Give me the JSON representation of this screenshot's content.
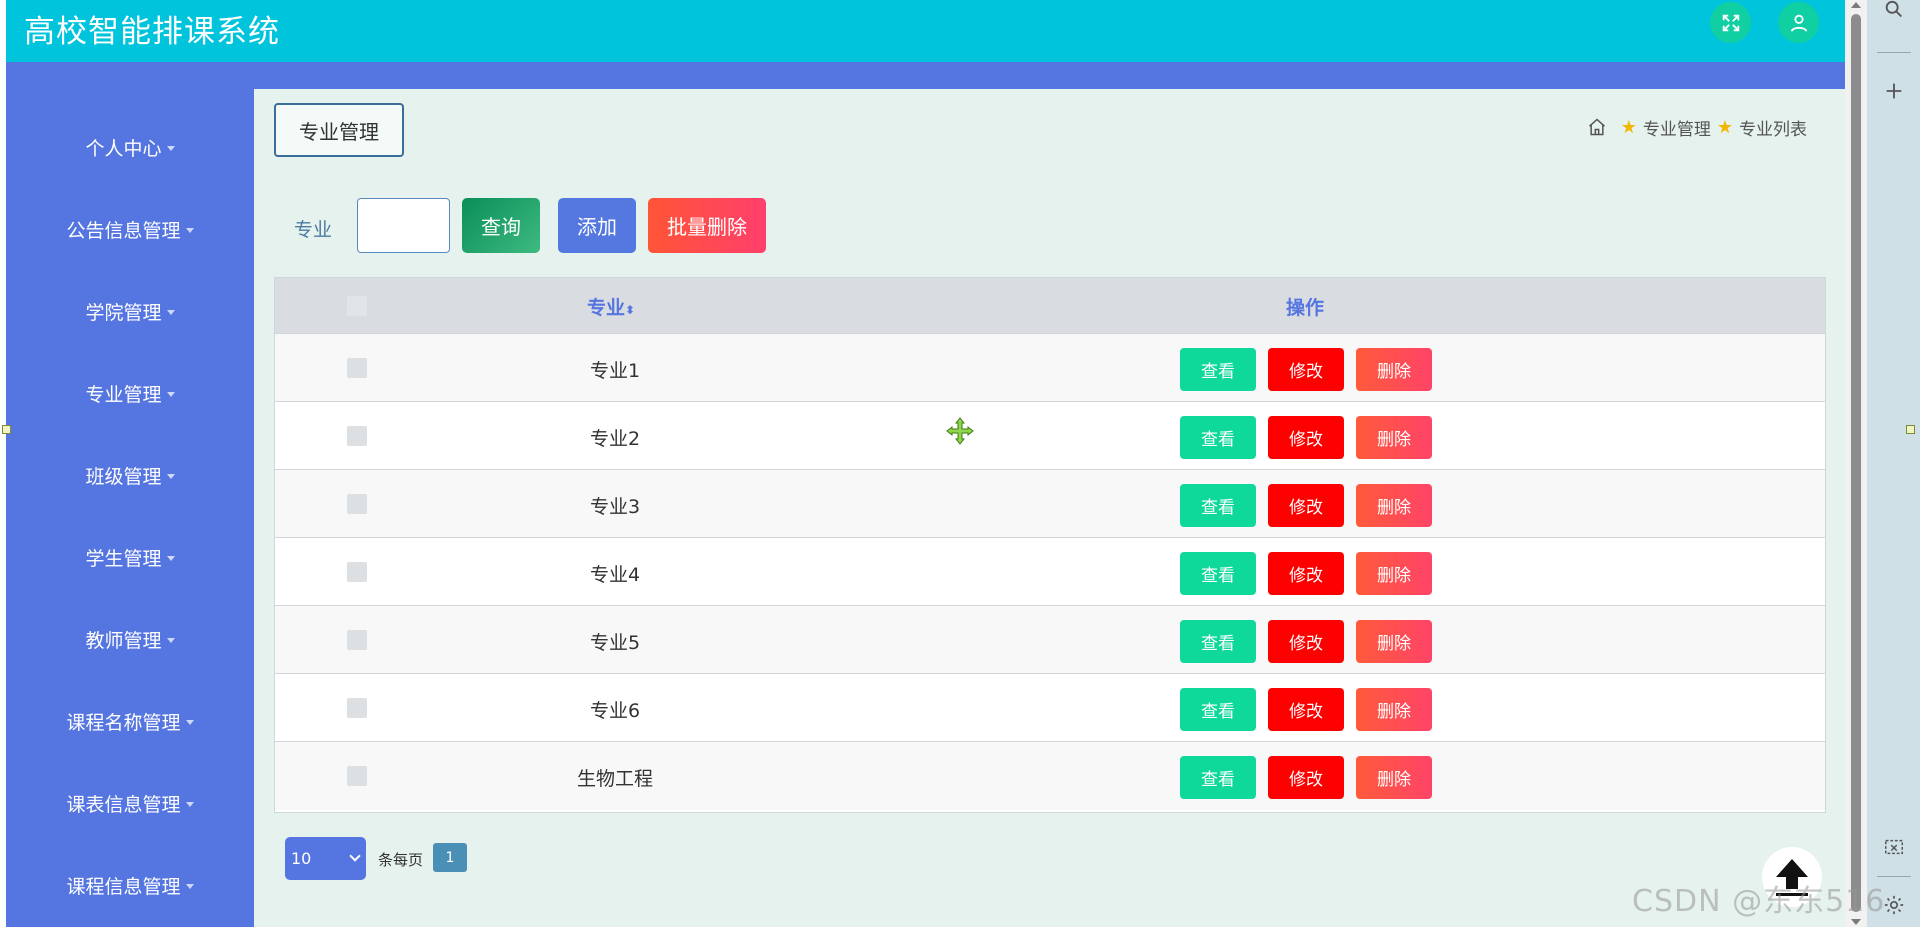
{
  "app": {
    "title": "高校智能排课系统"
  },
  "header": {
    "fullscreen_icon": "expand-icon",
    "user_icon": "user-icon"
  },
  "sidebar": {
    "items": [
      {
        "label": "个人中心"
      },
      {
        "label": "公告信息管理"
      },
      {
        "label": "学院管理"
      },
      {
        "label": "专业管理"
      },
      {
        "label": "班级管理"
      },
      {
        "label": "学生管理"
      },
      {
        "label": "教师管理"
      },
      {
        "label": "课程名称管理"
      },
      {
        "label": "课表信息管理"
      },
      {
        "label": "课程信息管理"
      }
    ]
  },
  "page": {
    "title": "专业管理",
    "breadcrumb": [
      "专业管理",
      "专业列表"
    ]
  },
  "search": {
    "label": "专业",
    "value": "",
    "query_button": "查询",
    "add_button": "添加",
    "batch_delete_button": "批量删除"
  },
  "table": {
    "columns": [
      "专业",
      "操作"
    ],
    "sort_indicator": "⬍",
    "rows": [
      {
        "name": "专业1"
      },
      {
        "name": "专业2"
      },
      {
        "name": "专业3"
      },
      {
        "name": "专业4"
      },
      {
        "name": "专业5"
      },
      {
        "name": "专业6"
      },
      {
        "name": "生物工程"
      }
    ],
    "actions": {
      "view": "查看",
      "edit": "修改",
      "delete": "删除"
    }
  },
  "pagination": {
    "page_size": "10",
    "per_page_label": "条每页",
    "current_page": "1"
  },
  "watermark": "CSDN @东东516",
  "colors": {
    "header": "#00c4dc",
    "sidebar": "#5575e0",
    "main_bg": "#e6f2ee",
    "view": "#0fd99a",
    "edit": "#ff0000",
    "delete": "#ff4d50"
  }
}
